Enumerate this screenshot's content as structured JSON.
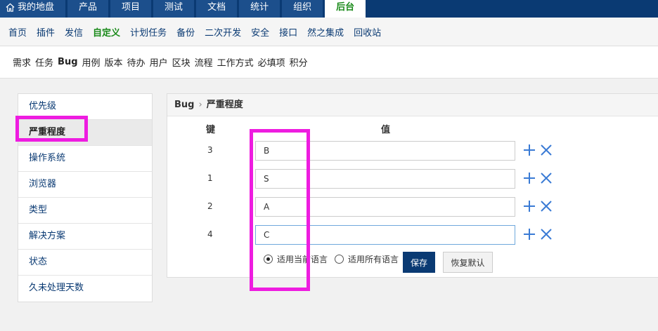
{
  "topnav": {
    "tabs": [
      "我的地盘",
      "产品",
      "项目",
      "测试",
      "文档",
      "统计",
      "组织",
      "后台"
    ],
    "active_index": 7
  },
  "subnav": {
    "items": [
      "首页",
      "插件",
      "发信",
      "自定义",
      "计划任务",
      "备份",
      "二次开发",
      "安全",
      "接口",
      "然之集成",
      "回收站"
    ],
    "active_index": 3
  },
  "thirdnav": {
    "items": [
      "需求",
      "任务",
      "Bug",
      "用例",
      "版本",
      "待办",
      "用户",
      "区块",
      "流程",
      "工作方式",
      "必填项",
      "积分"
    ],
    "active_index": 2
  },
  "sidebar": {
    "items": [
      "优先级",
      "严重程度",
      "操作系统",
      "浏览器",
      "类型",
      "解决方案",
      "状态",
      "久未处理天数"
    ],
    "active_index": 1
  },
  "panel": {
    "breadcrumb": [
      "Bug",
      "严重程度"
    ],
    "col_key": "键",
    "col_value": "值",
    "rows": [
      {
        "key": "3",
        "value": "B"
      },
      {
        "key": "1",
        "value": "S"
      },
      {
        "key": "2",
        "value": "A"
      },
      {
        "key": "4",
        "value": "C"
      }
    ],
    "option_current": "适用当前语言",
    "option_all": "适用所有语言",
    "selected_option": "current",
    "save_label": "保存",
    "reset_label": "恢复默认"
  },
  "colors": {
    "nav_bg": "#0a3a73",
    "active_green": "#1a8a1a",
    "highlight": "#ee1ce0"
  }
}
